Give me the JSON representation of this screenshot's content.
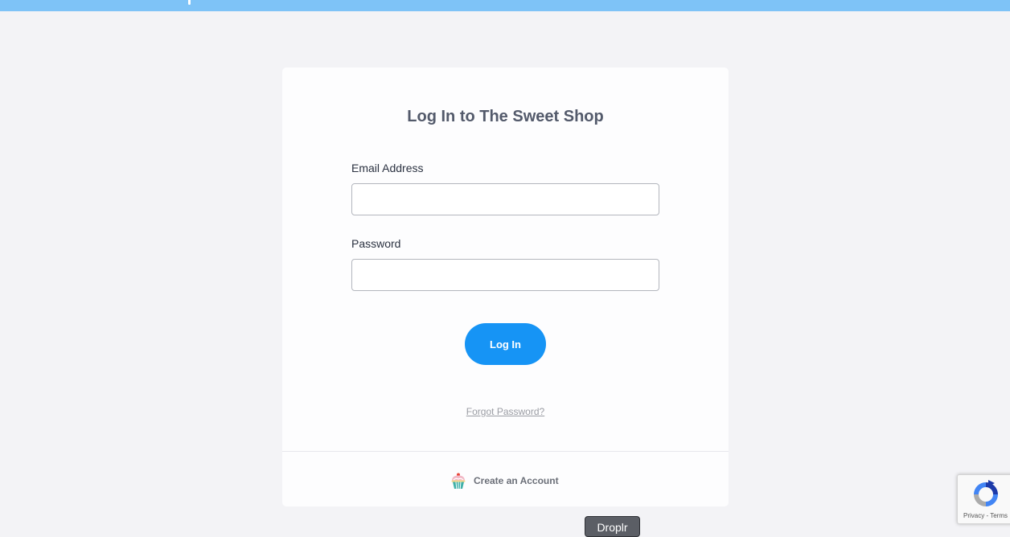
{
  "page": {
    "title": "Log In to The Sweet Shop"
  },
  "form": {
    "email_label": "Email Address",
    "email_value": "",
    "password_label": "Password",
    "password_value": "",
    "login_button": "Log In",
    "forgot_link": "Forgot Password?"
  },
  "footer": {
    "create_account": "Create an Account",
    "icon": "cupcake-icon"
  },
  "recaptcha": {
    "privacy": "Privacy",
    "separator": " - ",
    "terms": "Terms",
    "icon": "recaptcha-icon"
  },
  "overlay": {
    "droplr_label": "Droplr"
  },
  "colors": {
    "top_bar": "#7ec3f7",
    "background": "#f3f3f6",
    "card": "#fdfdfe",
    "primary_button": "#1694f5",
    "title_text": "#535a6b"
  }
}
